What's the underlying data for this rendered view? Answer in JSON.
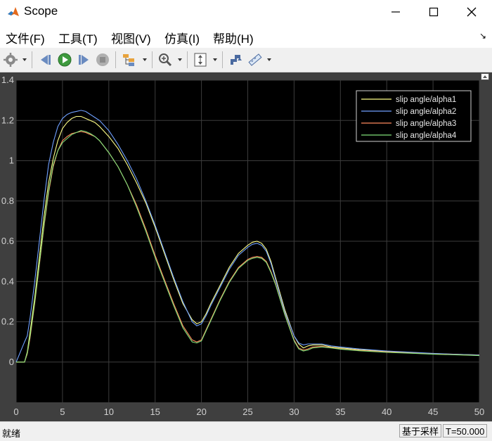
{
  "window": {
    "title": "Scope"
  },
  "menu": {
    "items": [
      "文件(F)",
      "工具(T)",
      "视图(V)",
      "仿真(I)",
      "帮助(H)"
    ]
  },
  "status": {
    "left_text": "就绪",
    "mode": "基于采样",
    "time": "T=50.000"
  },
  "colors": {
    "plot_bg": "#000000",
    "frame_bg": "#3f3f3f",
    "axis_text": "#d0d0d0",
    "grid": "#3c3c3c"
  },
  "toolbar_icons": [
    "gear-icon",
    "step-back-icon",
    "run-icon",
    "step-forward-icon",
    "stop-icon",
    "signal-hierarchy-icon",
    "zoom-icon",
    "autoscale-icon",
    "highlight-block-icon",
    "measure-icon"
  ],
  "chart_data": {
    "type": "line",
    "title": "",
    "xlabel": "",
    "ylabel": "",
    "xlim": [
      0,
      50
    ],
    "ylim": [
      -0.2,
      1.4
    ],
    "xticks": [
      0,
      5,
      10,
      15,
      20,
      25,
      30,
      35,
      40,
      45,
      50
    ],
    "yticks": [
      0,
      0.2,
      0.4,
      0.6,
      0.8,
      1,
      1.2,
      1.4
    ],
    "ytick_labels": [
      "0",
      "0.2",
      "0.4",
      "0.6",
      "0.8",
      "1",
      "1.2",
      "1.4"
    ],
    "grid": true,
    "legend": "top-right",
    "series": [
      {
        "name": "slip angle/alpha1",
        "color": "#ffff88",
        "x": [
          0,
          0.9,
          1.2,
          1.5,
          2,
          2.5,
          3,
          3.5,
          4,
          4.5,
          5,
          5.5,
          6,
          6.5,
          7,
          7.5,
          8,
          8.5,
          9,
          10,
          11,
          12,
          13,
          14,
          15,
          16,
          17,
          18,
          19,
          19.5,
          20,
          20.5,
          21,
          22,
          23,
          24,
          25,
          25.5,
          26,
          26.5,
          27,
          27.5,
          28,
          29,
          30,
          30.5,
          31,
          31.5,
          32,
          33,
          34,
          35,
          37,
          40,
          43,
          45,
          48,
          50
        ],
        "y": [
          0,
          0,
          0.05,
          0.15,
          0.32,
          0.52,
          0.72,
          0.89,
          1.01,
          1.1,
          1.16,
          1.19,
          1.21,
          1.22,
          1.22,
          1.21,
          1.2,
          1.19,
          1.17,
          1.12,
          1.06,
          0.98,
          0.89,
          0.79,
          0.67,
          0.54,
          0.41,
          0.29,
          0.21,
          0.19,
          0.2,
          0.24,
          0.29,
          0.38,
          0.47,
          0.54,
          0.58,
          0.595,
          0.6,
          0.59,
          0.56,
          0.5,
          0.42,
          0.26,
          0.13,
          0.09,
          0.07,
          0.08,
          0.085,
          0.085,
          0.075,
          0.07,
          0.062,
          0.053,
          0.046,
          0.042,
          0.038,
          0.035
        ]
      },
      {
        "name": "slip angle/alpha2",
        "color": "#6fa0ff",
        "x": [
          0,
          0.9,
          1.2,
          1.5,
          2,
          2.5,
          3,
          3.5,
          4,
          4.5,
          5,
          5.5,
          6,
          6.5,
          7,
          7.5,
          8,
          8.5,
          9,
          10,
          11,
          12,
          13,
          14,
          15,
          16,
          17,
          18,
          19,
          19.5,
          20,
          20.5,
          21,
          22,
          23,
          24,
          25,
          25.5,
          26,
          26.5,
          27,
          27.5,
          28,
          29,
          30,
          30.5,
          31,
          31.5,
          32,
          33,
          34,
          35,
          37,
          40,
          43,
          45,
          48,
          50
        ],
        "y": [
          0,
          0.1,
          0.13,
          0.22,
          0.4,
          0.6,
          0.8,
          0.98,
          1.09,
          1.17,
          1.21,
          1.23,
          1.24,
          1.245,
          1.25,
          1.245,
          1.23,
          1.215,
          1.2,
          1.15,
          1.08,
          1.0,
          0.91,
          0.8,
          0.68,
          0.55,
          0.42,
          0.3,
          0.2,
          0.18,
          0.19,
          0.23,
          0.28,
          0.37,
          0.46,
          0.53,
          0.57,
          0.585,
          0.59,
          0.58,
          0.55,
          0.49,
          0.41,
          0.25,
          0.13,
          0.095,
          0.085,
          0.09,
          0.09,
          0.09,
          0.08,
          0.075,
          0.065,
          0.055,
          0.048,
          0.043,
          0.038,
          0.035
        ]
      },
      {
        "name": "slip angle/alpha3",
        "color": "#ff8a5c",
        "x": [
          0,
          0.9,
          1.2,
          1.5,
          2,
          2.5,
          3,
          3.5,
          4,
          4.5,
          5,
          5.5,
          6,
          6.5,
          7,
          7.5,
          8,
          8.5,
          9,
          10,
          11,
          12,
          13,
          14,
          15,
          16,
          17,
          18,
          19,
          19.5,
          20,
          20.5,
          21,
          22,
          23,
          24,
          25,
          25.5,
          26,
          26.5,
          27,
          27.5,
          28,
          29,
          30,
          30.5,
          31,
          31.5,
          32,
          33,
          34,
          35,
          37,
          40,
          43,
          45,
          48,
          50
        ],
        "y": [
          0,
          0,
          0.04,
          0.12,
          0.29,
          0.48,
          0.67,
          0.84,
          0.97,
          1.05,
          1.1,
          1.12,
          1.135,
          1.14,
          1.145,
          1.14,
          1.13,
          1.12,
          1.1,
          1.04,
          0.97,
          0.88,
          0.78,
          0.66,
          0.53,
          0.41,
          0.29,
          0.18,
          0.11,
          0.1,
          0.11,
          0.16,
          0.21,
          0.31,
          0.4,
          0.47,
          0.51,
          0.52,
          0.525,
          0.52,
          0.5,
          0.45,
          0.39,
          0.24,
          0.11,
          0.07,
          0.06,
          0.065,
          0.075,
          0.078,
          0.072,
          0.066,
          0.058,
          0.05,
          0.044,
          0.04,
          0.036,
          0.033
        ]
      },
      {
        "name": "slip angle/alpha4",
        "color": "#80e07a",
        "x": [
          0,
          0.9,
          1.2,
          1.5,
          2,
          2.5,
          3,
          3.5,
          4,
          4.5,
          5,
          5.5,
          6,
          6.5,
          7,
          7.5,
          8,
          8.5,
          9,
          10,
          11,
          12,
          13,
          14,
          15,
          16,
          17,
          18,
          19,
          19.5,
          20,
          20.5,
          21,
          22,
          23,
          24,
          25,
          25.5,
          26,
          26.5,
          27,
          27.5,
          28,
          29,
          30,
          30.5,
          31,
          31.5,
          32,
          33,
          34,
          35,
          37,
          40,
          43,
          45,
          48,
          50
        ],
        "y": [
          0,
          0,
          0.045,
          0.13,
          0.3,
          0.49,
          0.68,
          0.85,
          0.98,
          1.05,
          1.09,
          1.11,
          1.13,
          1.14,
          1.15,
          1.145,
          1.135,
          1.12,
          1.1,
          1.04,
          0.97,
          0.88,
          0.77,
          0.65,
          0.52,
          0.4,
          0.28,
          0.17,
          0.1,
          0.095,
          0.105,
          0.155,
          0.205,
          0.305,
          0.395,
          0.465,
          0.505,
          0.515,
          0.52,
          0.515,
          0.495,
          0.445,
          0.385,
          0.235,
          0.105,
          0.065,
          0.055,
          0.06,
          0.07,
          0.075,
          0.07,
          0.064,
          0.056,
          0.048,
          0.043,
          0.039,
          0.035,
          0.032
        ]
      }
    ]
  }
}
